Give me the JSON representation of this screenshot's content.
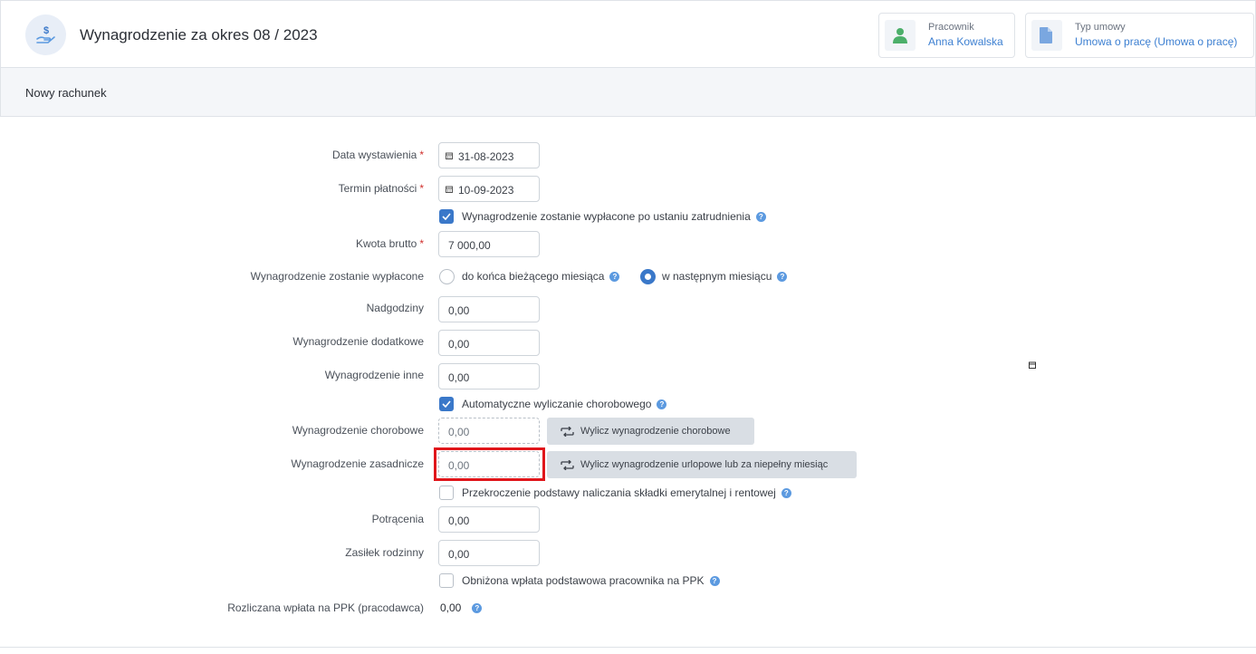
{
  "header": {
    "title": "Wynagrodzenie za okres 08 / 2023",
    "icon": "dollar-hand-icon",
    "employee": {
      "label": "Pracownik",
      "value": "Anna Kowalska",
      "icon": "user-icon"
    },
    "contract": {
      "label": "Typ umowy",
      "value": "Umowa o pracę (Umowa o pracę)",
      "icon": "document-icon"
    }
  },
  "section": {
    "title": "Nowy rachunek"
  },
  "form": {
    "issue_date": {
      "label": "Data wystawienia",
      "required": "*",
      "value": "31-08-2023"
    },
    "payment_term": {
      "label": "Termin płatności",
      "required": "*",
      "value": "10-09-2023"
    },
    "paid_after_termination": {
      "label": "Wynagrodzenie zostanie wypłacone po ustaniu zatrudnienia",
      "checked": true
    },
    "gross_amount": {
      "label": "Kwota brutto",
      "required": "*",
      "value": "7 000,00"
    },
    "payout_timing": {
      "label": "Wynagrodzenie zostanie wypłacone",
      "options": [
        "do końca bieżącego miesiąca",
        "w następnym miesiącu"
      ],
      "selected": "w następnym miesiącu"
    },
    "overtime": {
      "label": "Nadgodziny",
      "value": "0,00"
    },
    "additional_pay": {
      "label": "Wynagrodzenie dodatkowe",
      "value": "0,00"
    },
    "other_pay": {
      "label": "Wynagrodzenie inne",
      "value": "0,00"
    },
    "auto_sick_pay": {
      "label": "Automatyczne wyliczanie chorobowego",
      "checked": true
    },
    "sick_pay": {
      "label": "Wynagrodzenie chorobowe",
      "value": "0,00",
      "button": "Wylicz wynagrodzenie chorobowe"
    },
    "base_pay": {
      "label": "Wynagrodzenie zasadnicze",
      "value": "0,00",
      "button": "Wylicz wynagrodzenie urlopowe lub za niepełny miesiąc"
    },
    "pension_limit_exceeded": {
      "label": "Przekroczenie podstawy naliczania składki emerytalnej i rentowej",
      "checked": false
    },
    "deductions": {
      "label": "Potrącenia",
      "value": "0,00"
    },
    "family_allowance": {
      "label": "Zasiłek rodzinny",
      "value": "0,00"
    },
    "ppk_reduced": {
      "label": "Obniżona wpłata podstawowa pracownika na PPK",
      "checked": false
    },
    "ppk_employer": {
      "label": "Rozliczana wpłata na PPK (pracodawca)",
      "value": "0,00"
    }
  },
  "help_icon": "?",
  "colors": {
    "accent": "#3a78c9",
    "link": "#3c7fd1",
    "highlight": "#e0161b",
    "required": "#d0312d"
  }
}
